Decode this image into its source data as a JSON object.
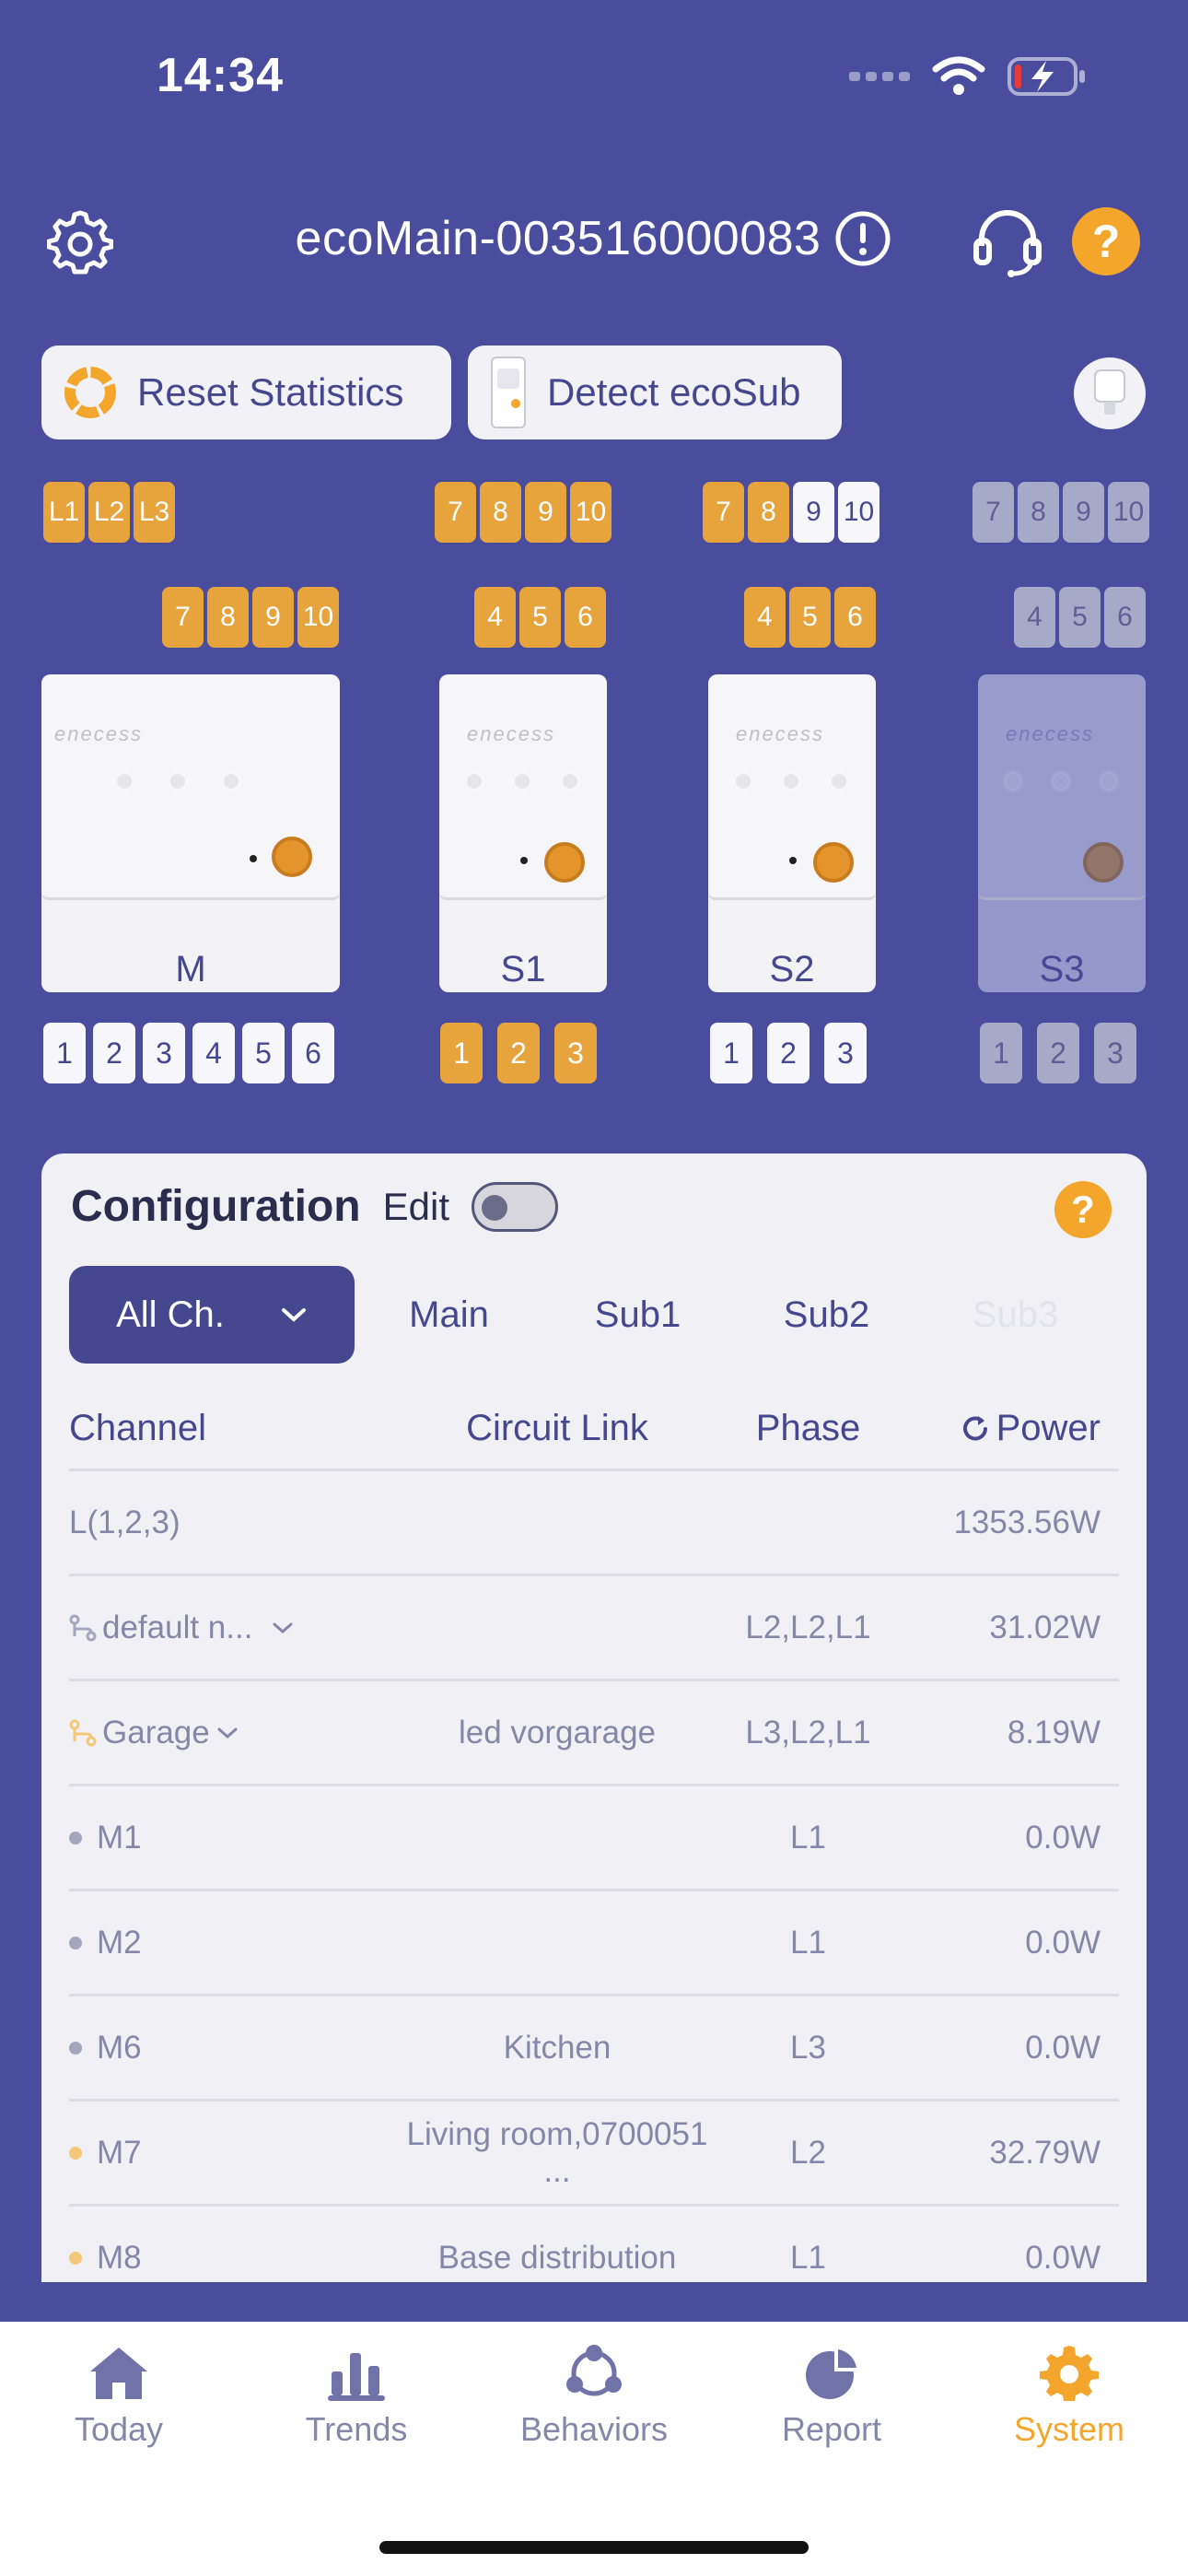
{
  "status_bar": {
    "time": "14:34"
  },
  "header": {
    "device_title": "ecoMain-003516000083"
  },
  "actions": {
    "reset_label": "Reset Statistics",
    "detect_label": "Detect ecoSub"
  },
  "chips": {
    "top_main": [
      "L1",
      "L2",
      "L3"
    ],
    "top_s1": [
      "7",
      "8",
      "9",
      "10"
    ],
    "top_s2": [
      "7",
      "8",
      "9",
      "10"
    ],
    "top_s3": [
      "7",
      "8",
      "9",
      "10"
    ],
    "mid_main": [
      "7",
      "8",
      "9",
      "10"
    ],
    "mid_s1": [
      "4",
      "5",
      "6"
    ],
    "mid_s2": [
      "4",
      "5",
      "6"
    ],
    "mid_s3": [
      "4",
      "5",
      "6"
    ],
    "bot_main": [
      "1",
      "2",
      "3",
      "4",
      "5",
      "6"
    ],
    "bot_s1": [
      "1",
      "2",
      "3"
    ],
    "bot_s2": [
      "1",
      "2",
      "3"
    ],
    "bot_s3": [
      "1",
      "2",
      "3"
    ]
  },
  "devices": {
    "main": "M",
    "s1": "S1",
    "s2": "S2",
    "s3": "S3",
    "brand": "enecess"
  },
  "config": {
    "title": "Configuration",
    "edit_label": "Edit",
    "edit_enabled": false,
    "tabs": {
      "all": "All Ch.",
      "main": "Main",
      "sub1": "Sub1",
      "sub2": "Sub2",
      "sub3": "Sub3"
    },
    "columns": {
      "channel": "Channel",
      "circuit": "Circuit Link",
      "phase": "Phase",
      "power": "Power"
    },
    "rows": [
      {
        "channel": "L(1,2,3)",
        "circuit": "",
        "phase": "",
        "power": "1353.56W"
      },
      {
        "channel": "default n...",
        "circuit": "",
        "phase": "L2,L2,L1",
        "power": "31.02W"
      },
      {
        "channel": "Garage",
        "circuit": "led vorgarage",
        "phase": "L3,L2,L1",
        "power": "8.19W"
      },
      {
        "channel": "M1",
        "circuit": "",
        "phase": "L1",
        "power": "0.0W"
      },
      {
        "channel": "M2",
        "circuit": "",
        "phase": "L1",
        "power": "0.0W"
      },
      {
        "channel": "M6",
        "circuit": "Kitchen",
        "phase": "L3",
        "power": "0.0W"
      },
      {
        "channel": "M7",
        "circuit": "Living room,0700051 ...",
        "phase": "L2",
        "power": "32.79W"
      },
      {
        "channel": "M8",
        "circuit": "Base distribution",
        "phase": "L1",
        "power": "0.0W"
      }
    ]
  },
  "nav": {
    "today": "Today",
    "trends": "Trends",
    "behaviors": "Behaviors",
    "report": "Report",
    "system": "System"
  },
  "colors": {
    "background": "#4a4d9e",
    "accent": "#f3a52c",
    "primary": "#45488f",
    "panel": "#f1f1f5"
  }
}
